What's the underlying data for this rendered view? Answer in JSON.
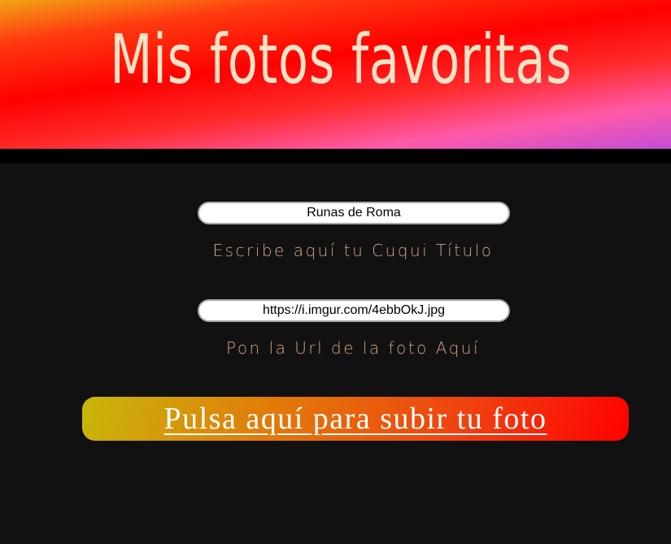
{
  "header": {
    "title": "Mis fotos favoritas"
  },
  "form": {
    "title_field": {
      "value": "Runas de Roma",
      "label": "Escribe aquí tu Cuqui Título"
    },
    "url_field": {
      "value": "https://i.imgur.com/4ebbOkJ.jpg",
      "label": "Pon la Url de la foto Aquí"
    },
    "submit_label": "Pulsa aquí para subir tu foto"
  },
  "colors": {
    "page_background": "#111111",
    "band": "#000000",
    "title_text": "#fde3c6",
    "label_text": "#d6a384",
    "button_text": "#ffffff"
  }
}
